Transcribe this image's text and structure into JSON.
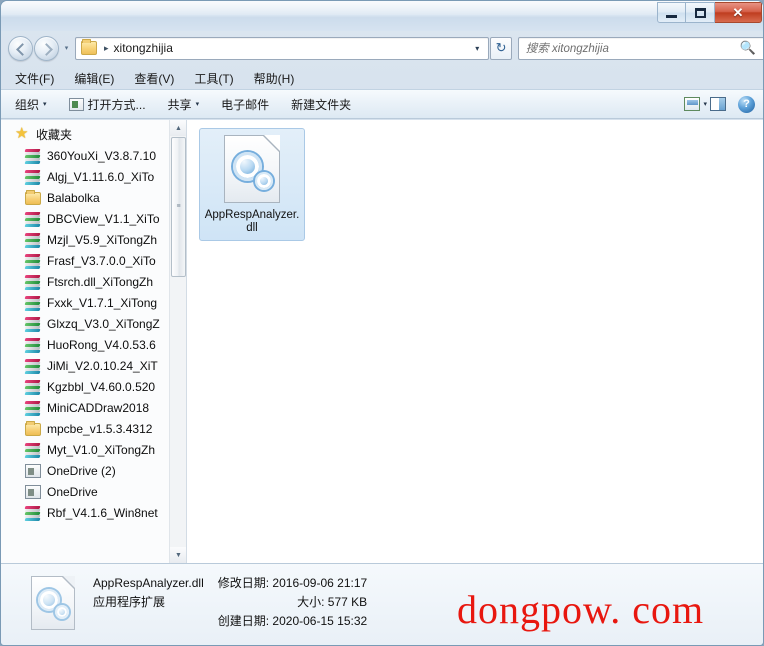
{
  "window": {
    "controls": {
      "minimize_label": "—",
      "maximize_label": "□",
      "close_label": "✕"
    }
  },
  "address_bar": {
    "back_icon": "back-arrow-icon",
    "forward_icon": "forward-arrow-icon",
    "history_caret": "▾",
    "folder_icon": "folder-icon",
    "separator": "▸",
    "path": "xitongzhijia",
    "dropdown_caret": "▾",
    "refresh_icon": "↻"
  },
  "search": {
    "placeholder": "搜索 xitongzhijia",
    "icon": "search-icon"
  },
  "menubar": {
    "items": [
      {
        "label": "文件(F)"
      },
      {
        "label": "编辑(E)"
      },
      {
        "label": "查看(V)"
      },
      {
        "label": "工具(T)"
      },
      {
        "label": "帮助(H)"
      }
    ]
  },
  "toolbar": {
    "organize_label": "组织",
    "open_with_label": "打开方式...",
    "share_label": "共享",
    "email_label": "电子邮件",
    "new_folder_label": "新建文件夹",
    "caret": "▾",
    "help_label": "?"
  },
  "sidebar": {
    "header": {
      "label": "收藏夹",
      "icon": "star-icon"
    },
    "items": [
      {
        "label": "360YouXi_V3.8.7.10",
        "icon": "rar-archive-icon"
      },
      {
        "label": "Algj_V1.11.6.0_XiTo",
        "icon": "rar-archive-icon"
      },
      {
        "label": "Balabolka",
        "icon": "folder-icon"
      },
      {
        "label": "DBCView_V1.1_XiTo",
        "icon": "rar-archive-icon"
      },
      {
        "label": "Mzjl_V5.9_XiTongZh",
        "icon": "rar-archive-icon"
      },
      {
        "label": "Frasf_V3.7.0.0_XiTo",
        "icon": "rar-archive-icon"
      },
      {
        "label": "Ftsrch.dll_XiTongZh",
        "icon": "rar-archive-icon"
      },
      {
        "label": "Fxxk_V1.7.1_XiTong",
        "icon": "rar-archive-icon"
      },
      {
        "label": "Glxzq_V3.0_XiTongZ",
        "icon": "rar-archive-icon"
      },
      {
        "label": "HuoRong_V4.0.53.6",
        "icon": "rar-archive-icon"
      },
      {
        "label": "JiMi_V2.0.10.24_XiT",
        "icon": "rar-archive-icon"
      },
      {
        "label": "Kgzbbl_V4.60.0.520",
        "icon": "rar-archive-icon"
      },
      {
        "label": "MiniCADDraw2018",
        "icon": "rar-archive-icon"
      },
      {
        "label": "mpcbe_v1.5.3.4312",
        "icon": "folder-icon"
      },
      {
        "label": "Myt_V1.0_XiTongZh",
        "icon": "rar-archive-icon"
      },
      {
        "label": "OneDrive (2)",
        "icon": "app-icon"
      },
      {
        "label": "OneDrive",
        "icon": "app-icon"
      },
      {
        "label": "Rbf_V4.1.6_Win8net",
        "icon": "rar-archive-icon"
      }
    ],
    "scrollbar": {
      "up_arrow": "▲",
      "down_arrow": "▼",
      "grip": "≡"
    }
  },
  "file_pane": {
    "files": [
      {
        "name": "AppRespAnalyzer.dll",
        "icon": "dll-gears-icon",
        "selected": true
      }
    ]
  },
  "details_pane": {
    "icon": "dll-gears-icon",
    "file_name": "AppRespAnalyzer.dll",
    "file_type": "应用程序扩展",
    "modified_label": "修改日期:",
    "modified_value": "2016-09-06 21:17",
    "size_label": "大小:",
    "size_value": "577 KB",
    "created_label": "创建日期:",
    "created_value": "2020-06-15 15:32"
  },
  "watermark": {
    "text": "dongpow. com",
    "color": "#e8170f"
  }
}
